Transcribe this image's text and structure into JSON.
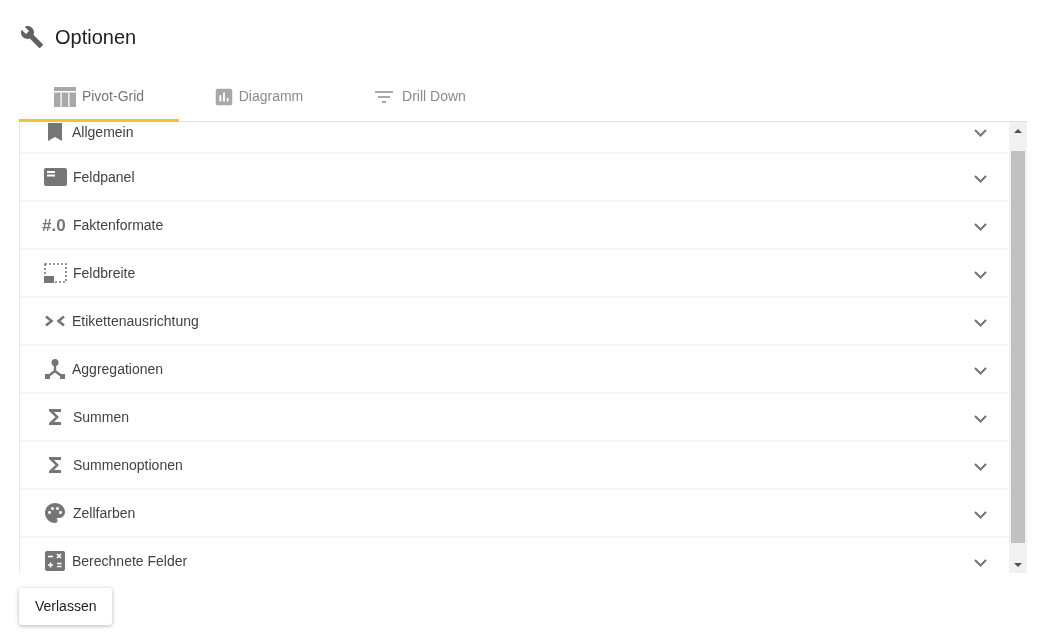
{
  "header": {
    "title": "Optionen"
  },
  "tabs": [
    {
      "label": "Pivot-Grid",
      "selected": true
    },
    {
      "label": "Diagramm",
      "selected": false
    },
    {
      "label": "Drill Down",
      "selected": false
    }
  ],
  "sections": [
    {
      "label": "Allgemein",
      "expanded": false
    },
    {
      "label": "Feldpanel",
      "expanded": false
    },
    {
      "label": "Faktenformate",
      "glyph": "#.0",
      "expanded": false
    },
    {
      "label": "Feldbreite",
      "expanded": false
    },
    {
      "label": "Etikettenausrichtung",
      "expanded": false
    },
    {
      "label": "Aggregationen",
      "expanded": false
    },
    {
      "label": "Summen",
      "expanded": false
    },
    {
      "label": "Summenoptionen",
      "expanded": false
    },
    {
      "label": "Zellfarben",
      "expanded": false
    },
    {
      "label": "Berechnete Felder",
      "expanded": false
    }
  ],
  "footer": {
    "buttons": [
      "Verlassen"
    ]
  }
}
